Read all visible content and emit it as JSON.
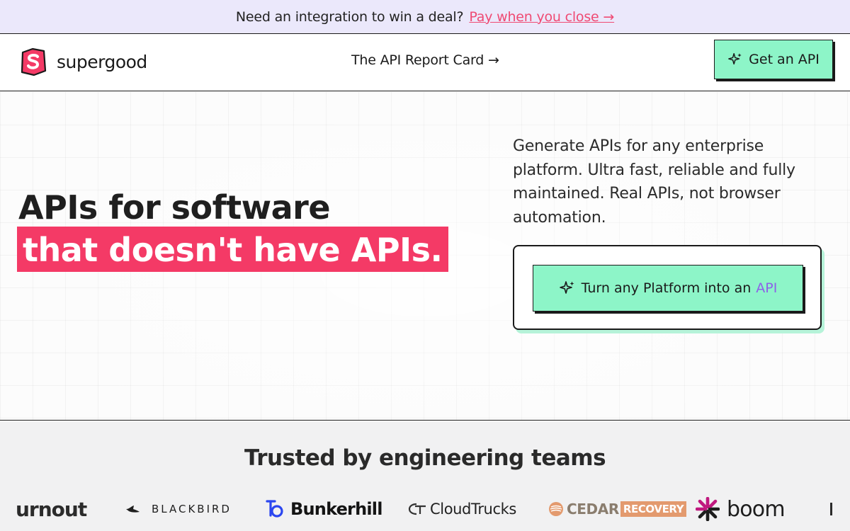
{
  "announcement": {
    "message": "Need an integration to win a deal?",
    "link_label": "Pay when you close →"
  },
  "header": {
    "brand_name": "supergood",
    "nav_link": "The API Report Card →",
    "cta_label": "Get an API"
  },
  "hero": {
    "headline_line1": "APIs for software",
    "headline_line2": "that doesn't have APIs.",
    "description": "Generate APIs for any enterprise platform. Ultra fast, reliable and fully maintained. Real APIs, not browser automation.",
    "cta_label": "Turn any Platform into an",
    "cta_accent": "API"
  },
  "trusted": {
    "heading": "Trusted by engineering teams",
    "logos": [
      "urnout",
      "BLACKBIRD",
      "Bunkerhill",
      "CloudTrucks",
      "CEDAR",
      "RECOVERY",
      "boom"
    ]
  },
  "colors": {
    "announcement_bg": "#ebe8fb",
    "link_pink": "#ef4a73",
    "highlight_pink": "#f43a66",
    "cta_green": "#8df5c8",
    "accent_purple": "#8d62e8",
    "section_bg": "#f1f1f2"
  },
  "icons": {
    "brand": "supergood-s-cape-icon",
    "cta": "sparkle-icon"
  }
}
